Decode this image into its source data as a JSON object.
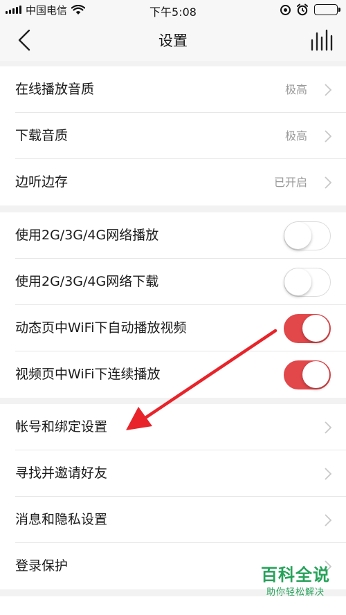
{
  "status_bar": {
    "carrier": "中国电信",
    "time": "下午5:08",
    "icons": [
      "signal-icon",
      "wifi-icon",
      "orientation-lock-icon",
      "alarm-icon",
      "battery-icon"
    ]
  },
  "nav": {
    "title": "设置",
    "back_icon": "back-chevron-icon",
    "right_icon": "equalizer-icon"
  },
  "groups": [
    {
      "rows": [
        {
          "label": "在线播放音质",
          "value": "极高",
          "type": "link"
        },
        {
          "label": "下载音质",
          "value": "极高",
          "type": "link"
        },
        {
          "label": "边听边存",
          "value": "已开启",
          "type": "link"
        }
      ]
    },
    {
      "rows": [
        {
          "label": "使用2G/3G/4G网络播放",
          "type": "toggle",
          "on": false
        },
        {
          "label": "使用2G/3G/4G网络下载",
          "type": "toggle",
          "on": false
        },
        {
          "label": "动态页中WiFi下自动播放视频",
          "type": "toggle",
          "on": true
        },
        {
          "label": "视频页中WiFi下连续播放",
          "type": "toggle",
          "on": true
        }
      ]
    },
    {
      "rows": [
        {
          "label": "帐号和绑定设置",
          "type": "link"
        },
        {
          "label": "寻找并邀请好友",
          "type": "link"
        },
        {
          "label": "消息和隐私设置",
          "type": "link"
        },
        {
          "label": "登录保护",
          "type": "link"
        }
      ]
    }
  ],
  "annotation": {
    "color": "#e8232a"
  },
  "watermark": {
    "title": "百科全说",
    "subtitle": "助你轻松解决"
  },
  "colors": {
    "accent": "#e2474a",
    "watermark": "#25a25a"
  }
}
